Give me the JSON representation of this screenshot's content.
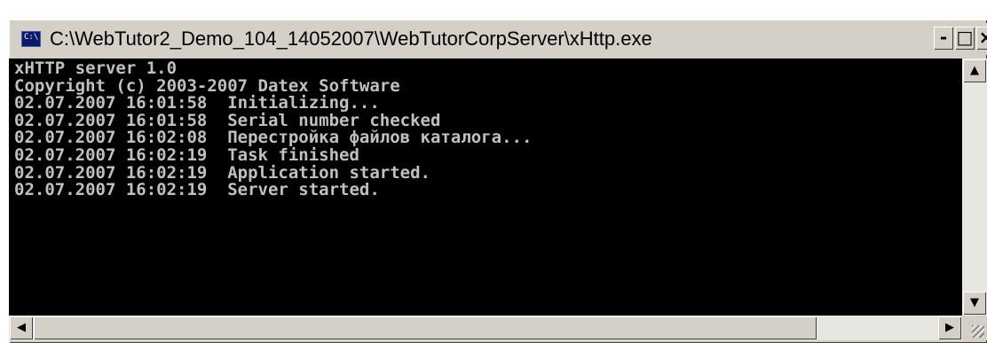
{
  "window": {
    "title": "C:\\WebTutor2_Demo_104_14052007\\WebTutorCorpServer\\xHttp.exe",
    "icon": "console-icon",
    "icon_text": "C:\\",
    "buttons": {
      "minimize": "-",
      "maximize": "□",
      "close": "×"
    }
  },
  "console": {
    "lines": [
      "xHTTP server 1.0",
      "Copyright (c) 2003-2007 Datex Software",
      "02.07.2007 16:01:58  Initializing...",
      "02.07.2007 16:01:58  Serial number checked",
      "02.07.2007 16:02:08  Перестройка файлов каталога...",
      "02.07.2007 16:02:19  Task finished",
      "02.07.2007 16:02:19  Application started.",
      "02.07.2007 16:02:19  Server started."
    ]
  },
  "scrollbars": {
    "up_arrow": "▲",
    "down_arrow": "▼",
    "left_arrow": "◀",
    "right_arrow": "▶"
  },
  "colors": {
    "console_bg": "#000000",
    "console_text": "#c0c0c0",
    "chrome": "#d4d0c8",
    "heading_blue": "#1a2fd6"
  }
}
